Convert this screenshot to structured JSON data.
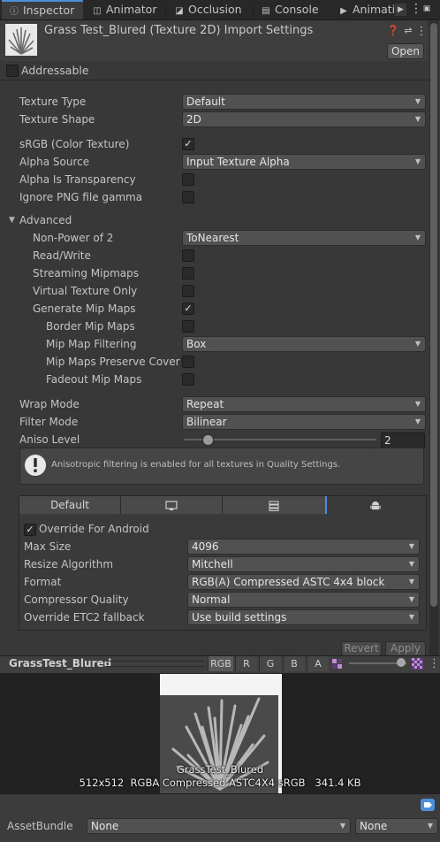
{
  "tabs": [
    {
      "label": "Inspector",
      "icon": "info-icon"
    },
    {
      "label": "Animator",
      "icon": "animator-icon"
    },
    {
      "label": "Occlusion",
      "icon": "occlusion-icon"
    },
    {
      "label": "Console",
      "icon": "console-icon"
    },
    {
      "label": "Animatio",
      "icon": "animation-icon"
    }
  ],
  "header": {
    "title": "Grass Test_Blured (Texture 2D) Import Settings",
    "open_label": "Open",
    "addressable_label": "Addressable",
    "addressable_checked": false
  },
  "settings": {
    "texture_type": {
      "label": "Texture Type",
      "value": "Default"
    },
    "texture_shape": {
      "label": "Texture Shape",
      "value": "2D"
    },
    "srgb": {
      "label": "sRGB (Color Texture)",
      "checked": true
    },
    "alpha_source": {
      "label": "Alpha Source",
      "value": "Input Texture Alpha"
    },
    "alpha_transparency": {
      "label": "Alpha Is Transparency",
      "checked": false
    },
    "ignore_png_gamma": {
      "label": "Ignore PNG file gamma",
      "checked": false
    }
  },
  "advanced": {
    "label": "Advanced",
    "non_power_of_2": {
      "label": "Non-Power of 2",
      "value": "ToNearest"
    },
    "read_write": {
      "label": "Read/Write",
      "checked": false
    },
    "streaming_mipmaps": {
      "label": "Streaming Mipmaps",
      "checked": false
    },
    "virtual_texture_only": {
      "label": "Virtual Texture Only",
      "checked": false
    },
    "generate_mip_maps": {
      "label": "Generate Mip Maps",
      "checked": true
    },
    "border_mip_maps": {
      "label": "Border Mip Maps",
      "checked": false
    },
    "mip_map_filtering": {
      "label": "Mip Map Filtering",
      "value": "Box"
    },
    "mip_maps_preserve_coverage": {
      "label": "Mip Maps Preserve Covera",
      "checked": false
    },
    "fadeout_mip_maps": {
      "label": "Fadeout Mip Maps",
      "checked": false
    }
  },
  "wrap": {
    "wrap_mode": {
      "label": "Wrap Mode",
      "value": "Repeat"
    },
    "filter_mode": {
      "label": "Filter Mode",
      "value": "Bilinear"
    },
    "aniso_level": {
      "label": "Aniso Level",
      "value": "2",
      "slider_fraction": 0.125
    }
  },
  "info": {
    "text": "Anisotropic filtering is enabled for all textures in Quality Settings.",
    "icon": "warning-icon"
  },
  "platform": {
    "tabs": [
      {
        "label": "Default",
        "icon": ""
      },
      {
        "label": "",
        "icon": "monitor-icon"
      },
      {
        "label": "",
        "icon": "server-icon"
      },
      {
        "label": "",
        "icon": "android-icon"
      }
    ],
    "override_label": "Override For Android",
    "override_checked": true,
    "max_size": {
      "label": "Max Size",
      "value": "4096"
    },
    "resize_algorithm": {
      "label": "Resize Algorithm",
      "value": "Mitchell"
    },
    "format": {
      "label": "Format",
      "value": "RGB(A) Compressed ASTC 4x4 block"
    },
    "compressor_quality": {
      "label": "Compressor Quality",
      "value": "Normal"
    },
    "override_etc2": {
      "label": "Override ETC2 fallback",
      "value": "Use build settings"
    }
  },
  "actions": {
    "revert": "Revert",
    "apply": "Apply"
  },
  "preview": {
    "name": "GrassTest_Blured",
    "channels": [
      "RGB",
      "R",
      "G",
      "B",
      "A"
    ],
    "caption_name": "GrassTest_Blured",
    "caption_info": "512x512  RGBA Compressed ASTC4X4 sRGB   341.4 KB"
  },
  "asset_bundle": {
    "label": "AssetBundle",
    "name": "None",
    "variant": "None"
  },
  "colors": {
    "accent": "#4d8fd8",
    "background": "#383838"
  }
}
